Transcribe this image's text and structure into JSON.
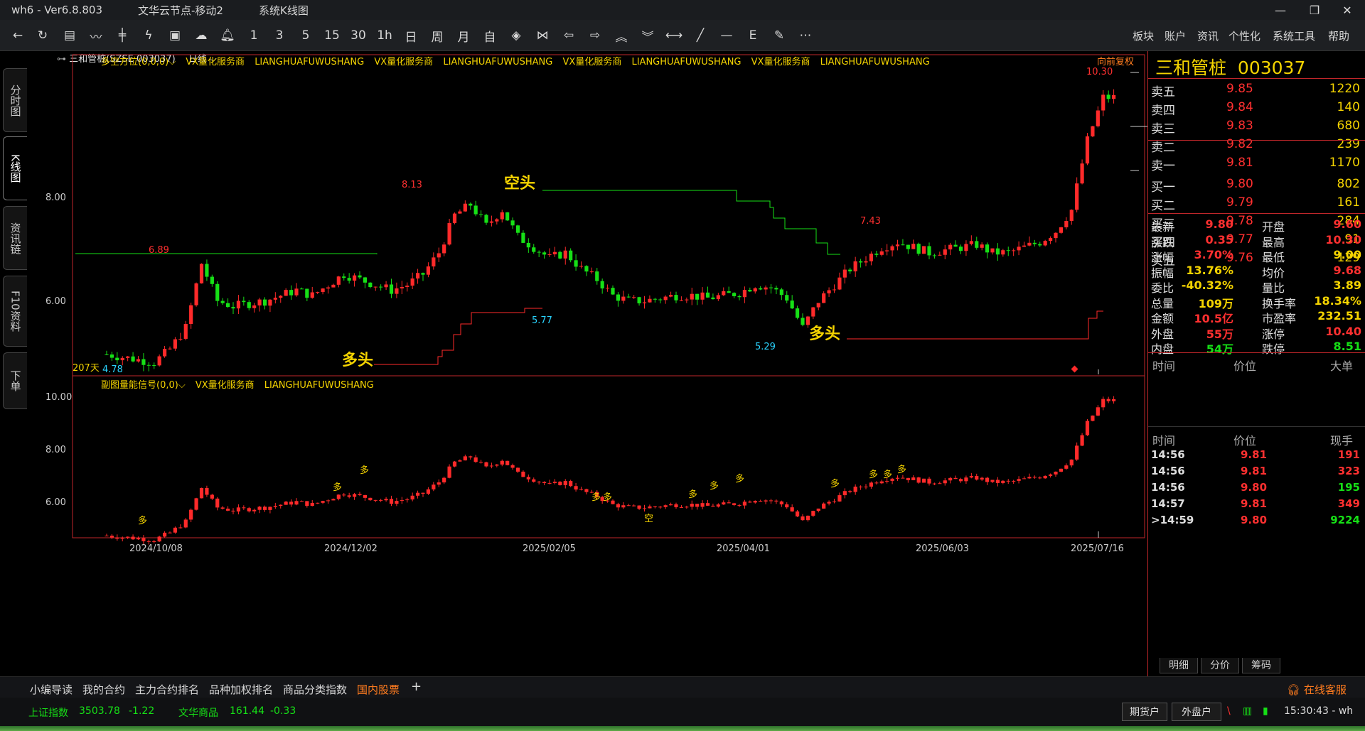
{
  "titlebar": {
    "app": "wh6 - Ver6.8.803",
    "node": "文华云节点-移动2",
    "view": "系统K线图",
    "min_icon": "minimize-icon",
    "max_icon": "restore-icon",
    "close_icon": "close-icon"
  },
  "toolbar": {
    "periods": [
      "1",
      "3",
      "5",
      "15",
      "30",
      "1h",
      "日",
      "周",
      "月",
      "自"
    ],
    "menus": [
      "板块",
      "账户",
      "资讯",
      "个性化",
      "系统工具",
      "帮助"
    ]
  },
  "left_tabs": [
    "分时图",
    "K线图",
    "资讯链",
    "F10资料",
    "下单"
  ],
  "chart": {
    "symbol_line": "三和管桩(SZSE 003037)",
    "period_label": "日线",
    "main_indicator": "多空方位(0,0,0)",
    "vendor_cn": "VX量化服务商",
    "vendor_en": "LIANGHUAFUWUSHANG",
    "adjust": "向前复权",
    "sub_indicator": "副图量能信号(0,0)",
    "days_label": "207天",
    "kong_label": "空头",
    "duo_label": "多头",
    "sig_duo": "多",
    "sig_kong": "空",
    "price_labels": [
      "10.30",
      "8.13",
      "7.43",
      "6.89",
      "5.77",
      "5.29",
      "4.78"
    ],
    "y_main_ticks": [
      "8.00",
      "6.00"
    ],
    "y_sub_ticks": [
      "10.00",
      "8.00",
      "6.00"
    ],
    "x_ticks": [
      "2024/10/08",
      "2024/12/02",
      "2025/02/05",
      "2025/04/01",
      "2025/06/03",
      "2025/07/16"
    ],
    "colors": {
      "up": "#ff2a2a",
      "down": "#16e016",
      "border": "#c0262a",
      "signal": "#f5d400",
      "line": "#16e016"
    }
  },
  "chart_data": {
    "type": "candlestick",
    "symbol": "三和管桩 003037",
    "x_ticks": [
      "2024/10/08",
      "2024/12/02",
      "2025/02/05",
      "2025/04/01",
      "2025/06/03",
      "2025/07/16"
    ],
    "ylim_main": [
      4.6,
      10.6
    ],
    "ylim_sub": [
      5.0,
      10.6
    ],
    "annotated_prices": {
      "high": 10.3,
      "peak1": 8.13,
      "peak2": 7.43,
      "start_high": 6.89,
      "low1": 5.77,
      "low2": 5.29,
      "low": 4.78
    },
    "close_series": [
      5.0,
      4.95,
      4.9,
      4.85,
      5.1,
      5.5,
      6.7,
      6.0,
      5.9,
      5.95,
      6.0,
      6.1,
      6.2,
      6.1,
      6.3,
      6.5,
      6.4,
      6.3,
      6.2,
      6.3,
      6.5,
      6.9,
      7.6,
      7.8,
      7.4,
      7.7,
      7.2,
      7.0,
      6.8,
      6.9,
      6.6,
      6.4,
      6.1,
      6.0,
      6.0,
      6.05,
      6.1,
      6.1,
      6.05,
      6.1,
      6.15,
      6.3,
      6.25,
      6.05,
      5.5,
      6.0,
      6.3,
      6.6,
      6.8,
      7.0,
      7.1,
      7.0,
      6.9,
      6.95,
      7.0,
      7.05,
      6.9,
      6.9,
      7.0,
      7.1,
      7.3,
      7.7,
      9.0,
      9.8
    ],
    "bid_ask": [
      {
        "label": "卖五",
        "price": "9.85",
        "vol": "1220"
      },
      {
        "label": "卖四",
        "price": "9.84",
        "vol": "140"
      },
      {
        "label": "卖三",
        "price": "9.83",
        "vol": "680"
      },
      {
        "label": "卖二",
        "price": "9.82",
        "vol": "239"
      },
      {
        "label": "卖一",
        "price": "9.81",
        "vol": "1170"
      },
      {
        "label": "买一",
        "price": "9.80",
        "vol": "802"
      },
      {
        "label": "买二",
        "price": "9.79",
        "vol": "161"
      },
      {
        "label": "买三",
        "price": "9.78",
        "vol": "284"
      },
      {
        "label": "买四",
        "price": "9.77",
        "vol": "91"
      },
      {
        "label": "买五",
        "price": "9.76",
        "vol": "129"
      }
    ]
  },
  "quote": {
    "title": "三和管桩",
    "code": "003037",
    "stats": [
      {
        "l1": "最新",
        "v1": "9.80",
        "c1": "#ff3030",
        "l2": "开盘",
        "v2": "9.60",
        "c2": "#ff3030"
      },
      {
        "l1": "涨跌",
        "v1": "0.35",
        "c1": "#ff3030",
        "l2": "最高",
        "v2": "10.30",
        "c2": "#ff3030"
      },
      {
        "l1": "涨幅",
        "v1": "3.70%",
        "c1": "#ff3030",
        "l2": "最低",
        "v2": "9.00",
        "c2": "#f5d400"
      },
      {
        "l1": "振幅",
        "v1": "13.76%",
        "c1": "#f5d400",
        "l2": "均价",
        "v2": "9.68",
        "c2": "#ff3030"
      },
      {
        "l1": "委比",
        "v1": "-40.32%",
        "c1": "#f5d400",
        "l2": "量比",
        "v2": "3.89",
        "c2": "#f5d400"
      },
      {
        "l1": "总量",
        "v1": "109万",
        "c1": "#f5d400",
        "l2": "换手率",
        "v2": "18.34%",
        "c2": "#f5d400"
      },
      {
        "l1": "金额",
        "v1": "10.5亿",
        "c1": "#ff3030",
        "l2": "市盈率",
        "v2": "232.51",
        "c2": "#f5d400"
      },
      {
        "l1": "外盘",
        "v1": "55万",
        "c1": "#ff3030",
        "l2": "涨停",
        "v2": "10.40",
        "c2": "#ff3030"
      },
      {
        "l1": "内盘",
        "v1": "54万",
        "c1": "#16e016",
        "l2": "跌停",
        "v2": "8.51",
        "c2": "#16e016"
      }
    ],
    "big_hdr": [
      "时间",
      "价位",
      "大单"
    ],
    "tick_hdr": [
      "时间",
      "价位",
      "现手"
    ],
    "ticks": [
      {
        "time": "14:56",
        "price": "9.81",
        "vol": "191",
        "vc": "#ff3030"
      },
      {
        "time": "14:56",
        "price": "9.81",
        "vol": "323",
        "vc": "#ff3030"
      },
      {
        "time": "14:56",
        "price": "9.80",
        "vol": "195",
        "vc": "#16e016"
      },
      {
        "time": "14:57",
        "price": "9.81",
        "vol": "349",
        "vc": "#ff3030"
      },
      {
        "time": ">14:59",
        "price": "9.80",
        "vol": "9224",
        "vc": "#16e016"
      }
    ],
    "tabs": [
      "明细",
      "分价",
      "筹码"
    ]
  },
  "bottom_tabs": [
    "小编导读",
    "我的合约",
    "主力合约排名",
    "品种加权排名",
    "商品分类指数",
    "国内股票"
  ],
  "add_tab": "+",
  "service": "在线客服",
  "status": {
    "idx1_name": "上证指数",
    "idx1_val": "3503.78",
    "idx1_chg": "-1.22",
    "idx2_name": "文华商品",
    "idx2_val": "161.44",
    "idx2_chg": "-0.33",
    "btn1": "期货户",
    "btn2": "外盘户",
    "time": "15:30:43 - wh"
  }
}
